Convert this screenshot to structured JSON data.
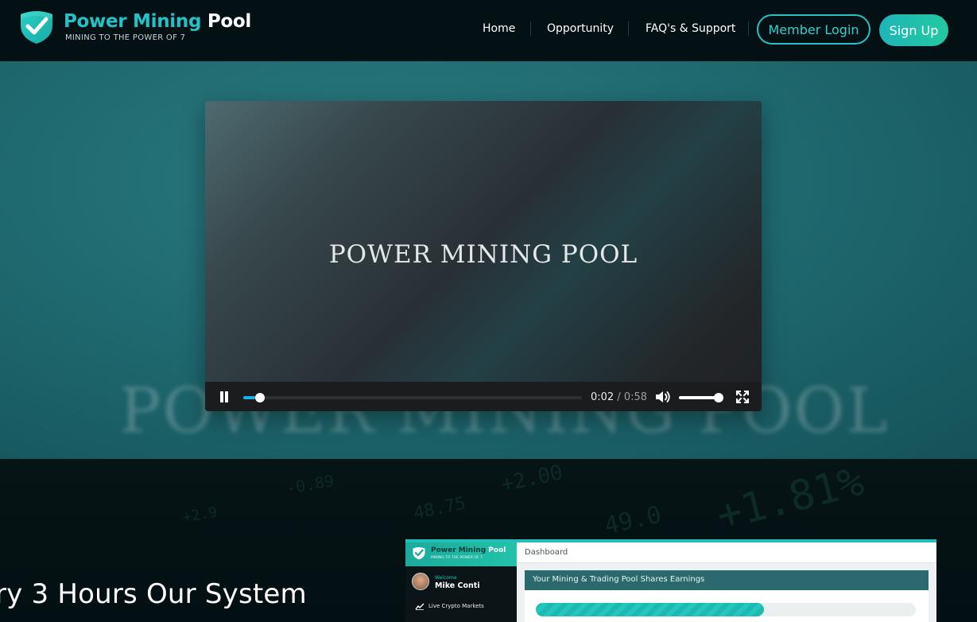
{
  "brand": {
    "name_accent": "Power Mining",
    "name_plain": "Pool",
    "tagline": "MINING TO THE POWER OF 7",
    "accent_color": "#22c3c8"
  },
  "nav": {
    "items": [
      {
        "label": "Home"
      },
      {
        "label": "Opportunity"
      },
      {
        "label": "FAQ's & Support"
      }
    ],
    "login_label": "Member Login",
    "signup_label": "Sign Up"
  },
  "hero": {
    "ghost_text": "POWER MINING POOL",
    "video": {
      "title": "POWER MINING POOL",
      "current_time": "0:02",
      "duration": "0:58",
      "progress_fraction": 0.035,
      "volume_fraction": 0.9,
      "icons": [
        "pause-icon",
        "volume-icon",
        "fullscreen-icon"
      ]
    }
  },
  "lower": {
    "headline": "ry 3 Hours Our System",
    "bg_digits": [
      "+2.00",
      "-0.89",
      "48.75",
      "+1.81%",
      "+2.9",
      "49.0"
    ]
  },
  "dashboard": {
    "brand_accent": "Power Mining",
    "brand_plain": "Pool",
    "brand_tagline": "MINING TO THE POWER OF 7",
    "welcome": "Welcome",
    "user": "Mike Conti",
    "menu_item": "Live Crypto Markets",
    "breadcrumb": "Dashboard",
    "panel_title": "Your Mining & Trading Pool Shares Earnings",
    "earnings_fraction": 0.6
  }
}
